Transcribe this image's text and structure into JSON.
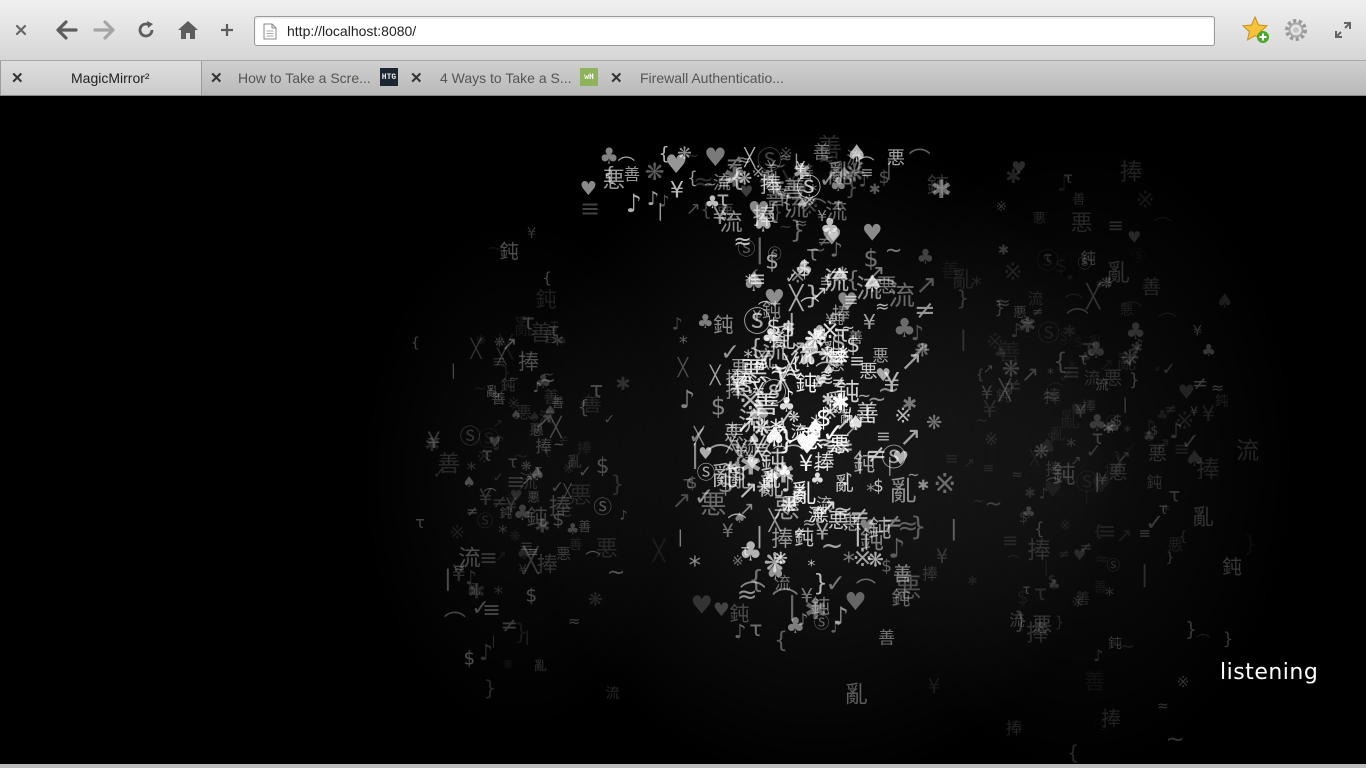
{
  "browser": {
    "url": "http://localhost:8080/",
    "toolbar": {
      "close_icon": "close-icon",
      "back_icon": "arrow-left-icon",
      "forward_icon": "arrow-right-icon",
      "reload_icon": "reload-icon",
      "home_icon": "home-icon",
      "new_tab_icon": "plus-icon",
      "bookmark_icon": "star-add-icon",
      "settings_icon": "gear-icon",
      "fullscreen_icon": "expand-icon"
    },
    "tabs": [
      {
        "title": "MagicMirror²",
        "active": true,
        "favicon": ""
      },
      {
        "title": "How to Take a Scre...",
        "active": false,
        "favicon": ""
      },
      {
        "title": "4 Ways to Take a S...",
        "active": false,
        "favicon": "HTG"
      },
      {
        "title": "Firewall Authenticatio...",
        "active": false,
        "favicon": "wH"
      }
    ]
  },
  "content": {
    "status_text": "listening",
    "glyph_set": [
      "※",
      "≡",
      "¥",
      "$",
      "♠",
      "♥",
      "♣",
      "✓",
      "⌒",
      "✱",
      "❋",
      "≈",
      "Ⓢ",
      "善",
      "悪",
      "鈍",
      "亂",
      "流",
      "捧",
      "τ",
      "↗",
      "≠",
      "♪",
      "{",
      "}",
      "~",
      "*",
      "╳",
      "|"
    ],
    "colors": {
      "background": "#000000",
      "glyph": "#ffffff"
    }
  }
}
